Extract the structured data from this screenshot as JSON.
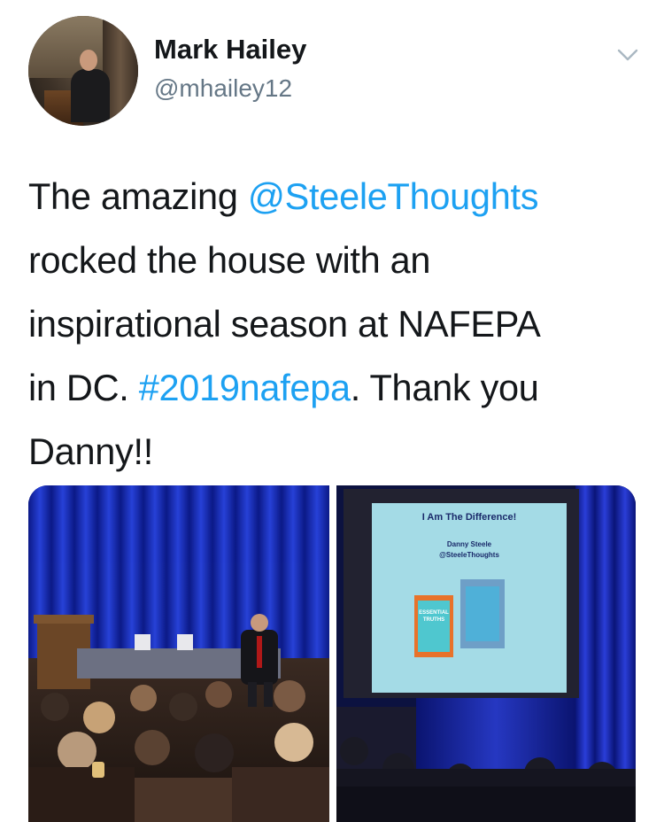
{
  "user": {
    "name": "Mark Hailey",
    "handle": "@mhailey12"
  },
  "tweet": {
    "lines": [
      [
        {
          "text": "The amazing "
        },
        {
          "text": "@SteeleThoughts",
          "link": true
        }
      ],
      [
        {
          "text": "rocked the house with an"
        }
      ],
      [
        {
          "text": "inspirational season at NAFEPA"
        }
      ],
      [
        {
          "text": "in DC. "
        },
        {
          "text": "#2019nafepa",
          "link": true
        },
        {
          "text": ".  Thank you"
        }
      ],
      [
        {
          "text": "Danny!!"
        }
      ]
    ]
  },
  "slide": {
    "title": "I Am The Difference!",
    "author": "Danny Steele",
    "author_handle": "@SteeleThoughts",
    "book_title": "ESSENTIAL TRUTHS"
  },
  "icons": {
    "menu": "chevron-down-icon"
  },
  "colors": {
    "link": "#1da1f2",
    "handle": "#657786",
    "text": "#14171a",
    "chevron": "#aab8c2"
  }
}
